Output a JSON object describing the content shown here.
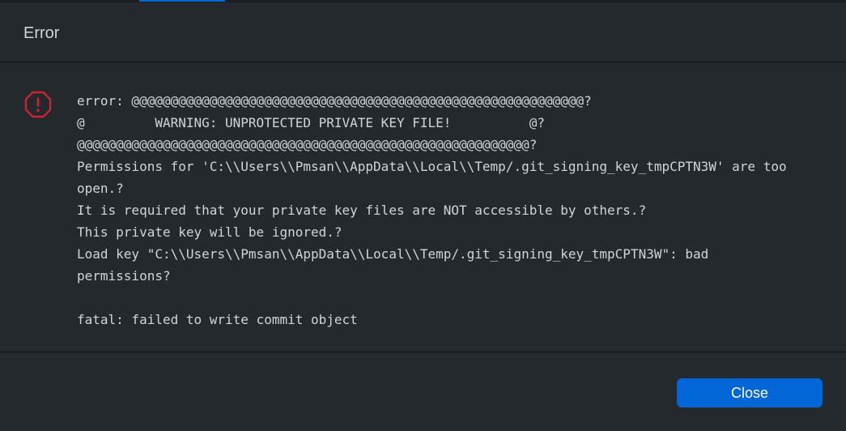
{
  "dialog": {
    "title": "Error",
    "icon": "error-octagon-icon",
    "message_lines": [
      "error: @@@@@@@@@@@@@@@@@@@@@@@@@@@@@@@@@@@@@@@@@@@@@@@@@@@@@@@@@@?",
      "@         WARNING: UNPROTECTED PRIVATE KEY FILE!          @?",
      "@@@@@@@@@@@@@@@@@@@@@@@@@@@@@@@@@@@@@@@@@@@@@@@@@@@@@@@@@@?",
      "Permissions for 'C:\\\\Users\\\\Pmsan\\\\AppData\\\\Local\\\\Temp/.git_signing_key_tmpCPTN3W' are too",
      "open.?",
      "It is required that your private key files are NOT accessible by others.?",
      "This private key will be ignored.?",
      "Load key \"C:\\\\Users\\\\Pmsan\\\\AppData\\\\Local\\\\Temp/.git_signing_key_tmpCPTN3W\": bad",
      "permissions?",
      "",
      "fatal: failed to write commit object"
    ],
    "close_label": "Close"
  },
  "colors": {
    "background": "#24292e",
    "text": "#d1d5da",
    "error_icon": "#cb2431",
    "button": "#0366d6"
  }
}
